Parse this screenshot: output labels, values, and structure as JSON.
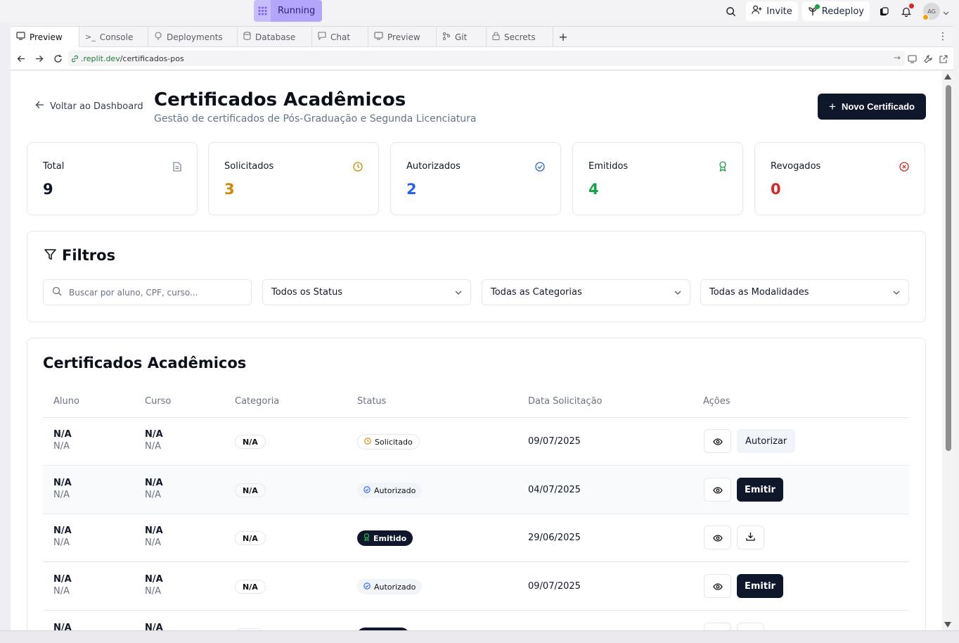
{
  "topbar": {
    "running_label": "Running",
    "invite_label": "Invite",
    "redeploy_label": "Redeploy",
    "avatar_initials": "AG"
  },
  "tabs": [
    {
      "label": "Preview",
      "icon": "preview-icon",
      "active": true
    },
    {
      "label": "Console",
      "icon": "console-icon",
      "active": false
    },
    {
      "label": "Deployments",
      "icon": "deployments-icon",
      "active": false
    },
    {
      "label": "Database",
      "icon": "database-icon",
      "active": false
    },
    {
      "label": "Chat",
      "icon": "chat-icon",
      "active": false
    },
    {
      "label": "Preview",
      "icon": "preview-icon",
      "active": false
    },
    {
      "label": "Git",
      "icon": "git-icon",
      "active": false
    },
    {
      "label": "Secrets",
      "icon": "lock-icon",
      "active": false
    }
  ],
  "url": {
    "host": ".replit.dev",
    "path": "/certificados-pos"
  },
  "header": {
    "back_label": "Voltar ao Dashboard",
    "title": "Certificados Acadêmicos",
    "subtitle": "Gestão de certificados de Pós-Graduação e Segunda Licenciatura",
    "new_button": "Novo Certificado"
  },
  "stats": [
    {
      "label": "Total",
      "value": "9",
      "color": "#0f172a",
      "icon": "document-icon"
    },
    {
      "label": "Solicitados",
      "value": "3",
      "color": "#ca8a04",
      "icon": "clock-icon"
    },
    {
      "label": "Autorizados",
      "value": "2",
      "color": "#2563eb",
      "icon": "check-circle-icon"
    },
    {
      "label": "Emitidos",
      "value": "4",
      "color": "#16a34a",
      "icon": "award-icon"
    },
    {
      "label": "Revogados",
      "value": "0",
      "color": "#dc2626",
      "icon": "x-circle-icon"
    }
  ],
  "filters": {
    "title": "Filtros",
    "search_placeholder": "Buscar por aluno, CPF, curso...",
    "status_select": "Todos os Status",
    "category_select": "Todas as Categorias",
    "modality_select": "Todas as Modalidades"
  },
  "table": {
    "title": "Certificados Acadêmicos",
    "columns": [
      "Aluno",
      "Curso",
      "Categoria",
      "Status",
      "Data Solicitação",
      "Ações"
    ],
    "rows": [
      {
        "aluno": "N/A",
        "aluno_sub": "N/A",
        "curso": "N/A",
        "curso_sub": "N/A",
        "categoria": "N/A",
        "status": "Solicitado",
        "data": "09/07/2025",
        "acao": "Autorizar"
      },
      {
        "aluno": "N/A",
        "aluno_sub": "N/A",
        "curso": "N/A",
        "curso_sub": "N/A",
        "categoria": "N/A",
        "status": "Autorizado",
        "data": "04/07/2025",
        "acao": "Emitir"
      },
      {
        "aluno": "N/A",
        "aluno_sub": "N/A",
        "curso": "N/A",
        "curso_sub": "N/A",
        "categoria": "N/A",
        "status": "Emitido",
        "data": "29/06/2025",
        "acao": ""
      },
      {
        "aluno": "N/A",
        "aluno_sub": "N/A",
        "curso": "N/A",
        "curso_sub": "N/A",
        "categoria": "N/A",
        "status": "Autorizado",
        "data": "09/07/2025",
        "acao": "Emitir"
      },
      {
        "aluno": "N/A",
        "aluno_sub": "",
        "curso": "N/A",
        "curso_sub": "",
        "categoria": "",
        "status": "",
        "data": "",
        "acao": ""
      }
    ]
  }
}
